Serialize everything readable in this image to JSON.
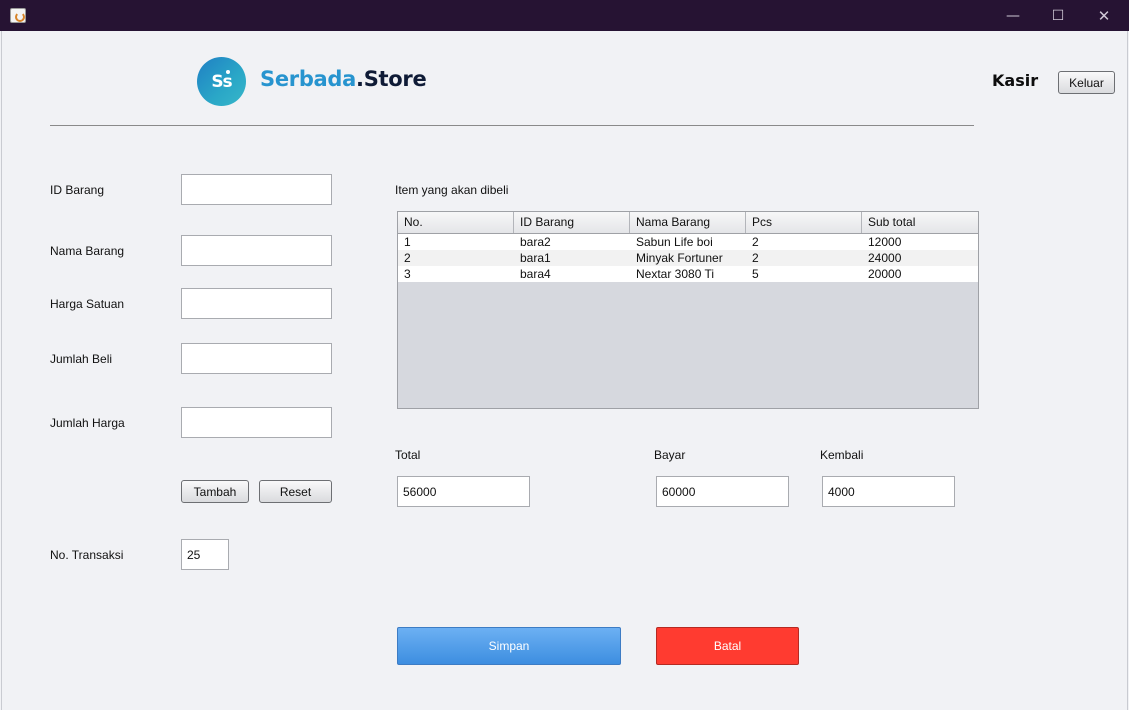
{
  "window": {
    "icon": "java-cup-icon",
    "controls": {
      "minimize": "—",
      "maximize": "☐",
      "close": "✕"
    }
  },
  "header": {
    "logo_text": "Ss",
    "brand_part1": "Serbada",
    "brand_part2": ".Store",
    "role": "Kasir",
    "logout_label": "Keluar"
  },
  "form": {
    "id_barang_label": "ID Barang",
    "nama_barang_label": "Nama Barang",
    "harga_satuan_label": "Harga Satuan",
    "jumlah_beli_label": "Jumlah Beli",
    "jumlah_harga_label": "Jumlah Harga",
    "id_barang_value": "",
    "nama_barang_value": "",
    "harga_satuan_value": "",
    "jumlah_beli_value": "",
    "jumlah_harga_value": "",
    "tambah_label": "Tambah",
    "reset_label": "Reset",
    "no_transaksi_label": "No. Transaksi",
    "no_transaksi_value": "25"
  },
  "table": {
    "caption": "Item yang akan dibeli",
    "columns": [
      "No.",
      "ID Barang",
      "Nama Barang",
      "Pcs",
      "Sub total"
    ],
    "rows": [
      [
        "1",
        "bara2",
        "Sabun Life boi",
        "2",
        "12000"
      ],
      [
        "2",
        "bara1",
        "Minyak Fortuner",
        "2",
        "24000"
      ],
      [
        "3",
        "bara4",
        "Nextar 3080 Ti",
        "5",
        "20000"
      ]
    ]
  },
  "summary": {
    "total_label": "Total",
    "total_value": "56000",
    "bayar_label": "Bayar",
    "bayar_value": "60000",
    "kembali_label": "Kembali",
    "kembali_value": "4000"
  },
  "actions": {
    "simpan_label": "Simpan",
    "batal_label": "Batal"
  },
  "colors": {
    "titlebar": "#261333",
    "brand_blue": "#2794cf",
    "simpan_blue": "#4a9ae6",
    "batal_red": "#ff3b30"
  }
}
